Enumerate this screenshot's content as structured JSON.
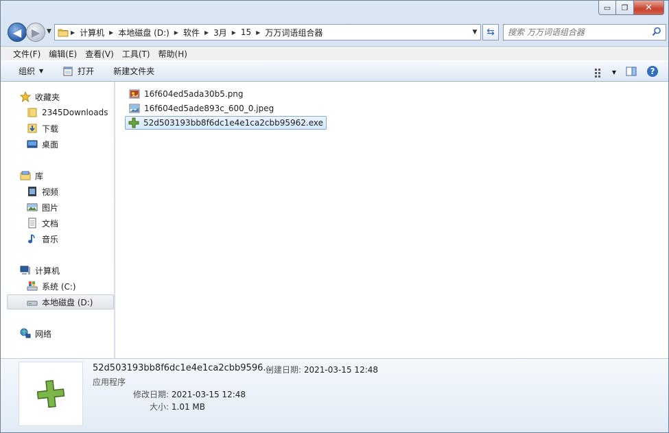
{
  "window": {
    "controls": {
      "minimize": "▭",
      "maximize": "❐",
      "close": "✕"
    }
  },
  "address": {
    "crumbs": [
      "计算机",
      "本地磁盘 (D:)",
      "软件",
      "3月",
      "15",
      "万万词语组合器"
    ]
  },
  "search": {
    "placeholder": "搜索 万万词语组合器"
  },
  "menu": [
    "文件(F)",
    "编辑(E)",
    "查看(V)",
    "工具(T)",
    "帮助(H)"
  ],
  "toolbar": {
    "organize": "组织",
    "open": "打开",
    "new_folder": "新建文件夹"
  },
  "nav": {
    "favorites": "收藏夹",
    "fav_items": [
      "2345Downloads",
      "下载",
      "桌面"
    ],
    "libraries": "库",
    "lib_items": [
      "视频",
      "图片",
      "文档",
      "音乐"
    ],
    "computer": "计算机",
    "drives": [
      "系统 (C:)",
      "本地磁盘 (D:)"
    ],
    "network": "网络"
  },
  "files": [
    {
      "name": "16f604ed5ada30b5.png",
      "icon": "png-image-icon"
    },
    {
      "name": "16f604ed5ade893c_600_0.jpeg",
      "icon": "jpeg-image-icon"
    },
    {
      "name": "52d503193bb8f6dc1e4e1ca2cbb95962.exe",
      "icon": "exe-plus-icon"
    }
  ],
  "details": {
    "name": "52d503193bb8f6dc1e4e1ca2cbb9596...",
    "type": "应用程序",
    "created_label": "创建日期:",
    "created": "2021-03-15 12:48",
    "modified_label": "修改日期:",
    "modified": "2021-03-15 12:48",
    "size_label": "大小:",
    "size": "1.01 MB"
  },
  "colors": {
    "accent": "#3c7fb1",
    "selection": "#d3e7fb",
    "exe_icon": "#6aa83a"
  }
}
